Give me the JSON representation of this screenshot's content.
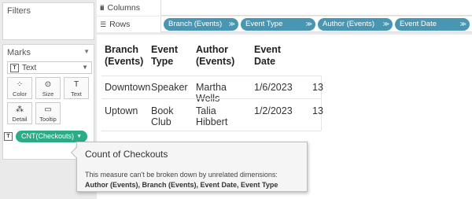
{
  "filters": {
    "title": "Filters"
  },
  "marks": {
    "title": "Marks",
    "mark_type": "Text",
    "buttons": [
      {
        "label": "Color",
        "icon": "color-icon"
      },
      {
        "label": "Size",
        "icon": "size-icon"
      },
      {
        "label": "Text",
        "icon": "text-icon"
      },
      {
        "label": "Detail",
        "icon": "detail-icon"
      },
      {
        "label": "Tooltip",
        "icon": "tooltip-icon"
      }
    ],
    "pill": {
      "label": "CNT(Checkouts)",
      "color": "#2bab86"
    }
  },
  "shelves": {
    "columns_label": "Columns",
    "rows_label": "Rows",
    "row_pills": [
      "Branch (Events)",
      "Event Type",
      "Author (Events)",
      "Event Date"
    ],
    "pill_color": "#4996b2"
  },
  "table": {
    "headers": [
      [
        "Branch",
        "(Events)"
      ],
      [
        "Event",
        "Type"
      ],
      [
        "Author",
        "(Events)"
      ],
      [
        "Event",
        "Date"
      ]
    ],
    "rows": [
      {
        "branch": "Downtown",
        "type": "Speaker",
        "author": "Martha Wells",
        "date": "1/6/2023",
        "count": "13"
      },
      {
        "branch": "Uptown",
        "type": "Book Club",
        "author": "Talia Hibbert",
        "date": "1/2/2023",
        "count": "13"
      }
    ]
  },
  "tooltip": {
    "title": "Count of Checkouts",
    "body": "This measure can't be broken down by unrelated dimensions:",
    "dims": "Author (Events), Branch (Events), Event Date, Event Type"
  }
}
